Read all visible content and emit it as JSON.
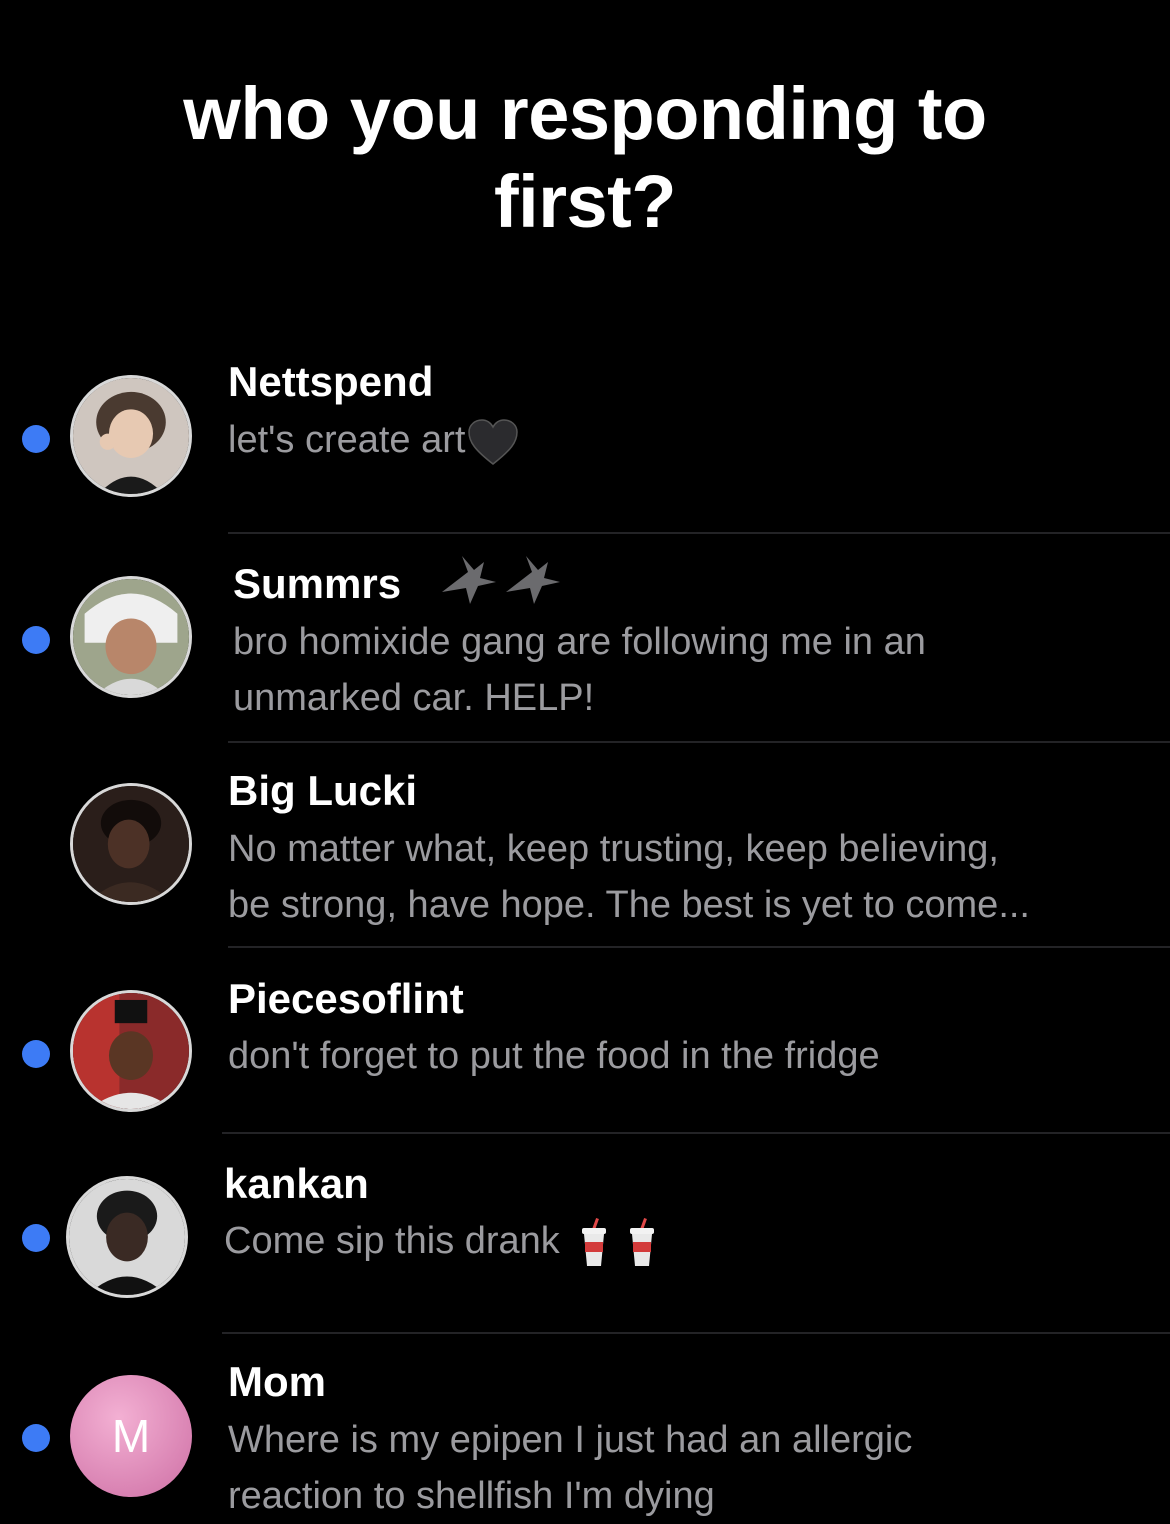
{
  "headline": {
    "line1": "who you responding to",
    "line2": "first?"
  },
  "threads": [
    {
      "name": "Nettspend",
      "preview_lines": [
        "let's create art"
      ],
      "preview_emoji": "black-heart-icon",
      "unread": true
    },
    {
      "name": "Summrs",
      "name_emoji": "eagle-icon",
      "preview_lines": [
        "bro homixide gang are following me in an",
        "unmarked car. HELP!"
      ],
      "unread": true
    },
    {
      "name": "Big Lucki",
      "preview_lines": [
        "No matter what, keep trusting, keep believing,",
        "be strong, have hope. The best is yet to come..."
      ],
      "unread": false
    },
    {
      "name": "Piecesoflint",
      "preview_lines": [
        "don't forget to put the food in the fridge"
      ],
      "unread": true
    },
    {
      "name": "kankan",
      "preview_lines": [
        "Come sip this drank"
      ],
      "preview_emoji": "cup-with-straw-icon",
      "unread": true
    },
    {
      "name": "Mom",
      "avatar_initial": "M",
      "preview_lines": [
        "Where is my epipen I just had an allergic",
        "reaction to shellfish I'm dying"
      ],
      "unread": true
    }
  ],
  "colors": {
    "background": "#000000",
    "unread_dot": "#3d7bf5",
    "name_text": "#ffffff",
    "preview_text": "#9b9b9f",
    "mom_avatar": "#e596c4"
  }
}
